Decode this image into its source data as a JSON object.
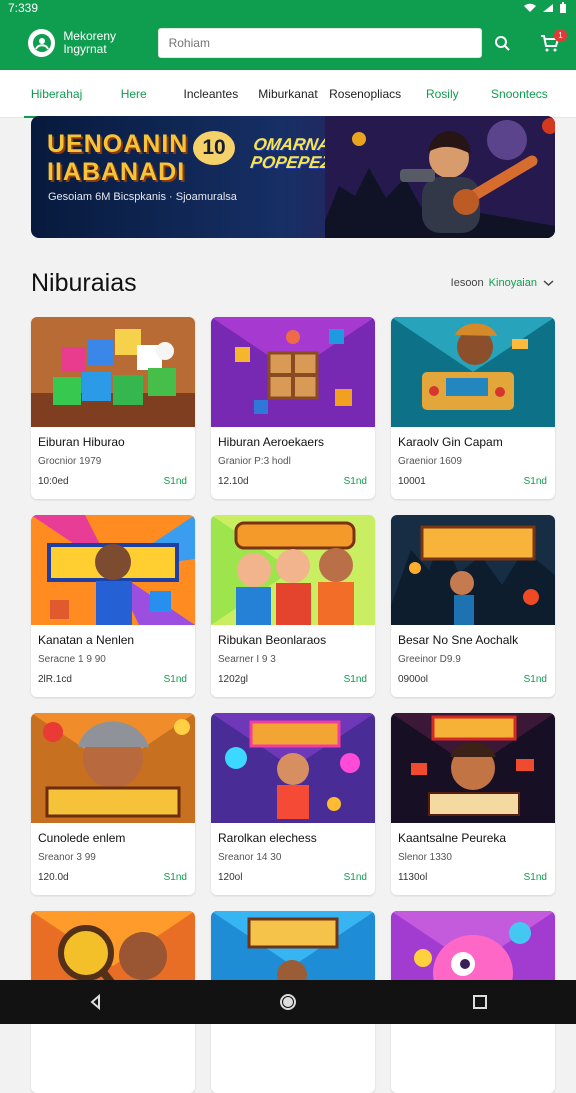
{
  "status": {
    "time": "7:339",
    "icons": [
      "wifi-icon",
      "signal-icon",
      "battery-icon"
    ]
  },
  "app": {
    "brand": "Mekoreny Ingyrnat",
    "search_placeholder": "Rohiam",
    "cart_count": "1",
    "accent": "#0f9d4f"
  },
  "tabs": [
    {
      "label": "Hiberahaj",
      "active": true
    },
    {
      "label": "Here"
    },
    {
      "label": "Incleantes"
    },
    {
      "label": "Miburkanat"
    },
    {
      "label": "Rosenopliacs"
    },
    {
      "label": "Rosily"
    },
    {
      "label": "Snoontecs"
    }
  ],
  "banner": {
    "title": "UENOANIN 1 IIABANADI",
    "badge": "10",
    "subtitle": "Gesoiam 6M Bicspkanis · Sjoamuralsa",
    "title2": "OMARNAIN POPEPEZLI"
  },
  "section": {
    "title": "Niburaias",
    "sort_label": "Iesoon",
    "sort_value": "Kinoyaian"
  },
  "products": [
    {
      "title": "Eiburan Hiburao",
      "meta": "Grocnior 1979",
      "price": "10:0ed",
      "tag": "S1nd"
    },
    {
      "title": "Hiburan Aeroekaers",
      "meta": "Granior P:3 hodl",
      "price": "12.10d",
      "tag": "S1nd"
    },
    {
      "title": "Karaolv Gin Capam",
      "meta": "Graenior 1609",
      "price": "10001",
      "tag": "S1nd"
    },
    {
      "title": "Kanatan a Nenlen",
      "meta": "Seracne 1 9 90",
      "price": "2lR.1cd",
      "tag": "S1nd"
    },
    {
      "title": "Ribukan Beonlaraos",
      "meta": "Searner I 9 3",
      "price": "1202gl",
      "tag": "S1nd"
    },
    {
      "title": "Besar No Sne Aochalk",
      "meta": "Greeinor D9.9",
      "price": "0900ol",
      "tag": "S1nd"
    },
    {
      "title": "Cunolede enlem",
      "meta": "Sreanor 3 99",
      "price": "120.0d",
      "tag": "S1nd"
    },
    {
      "title": "Rarolkan elechess",
      "meta": "Sreanor 14 30",
      "price": "120ol",
      "tag": "S1nd"
    },
    {
      "title": "Kaantsalne Peureka",
      "meta": "Slenor 1330",
      "price": "1130ol",
      "tag": "S1nd"
    }
  ],
  "more_products": 3,
  "nav": [
    "back-icon",
    "home-icon",
    "recent-apps-icon"
  ]
}
